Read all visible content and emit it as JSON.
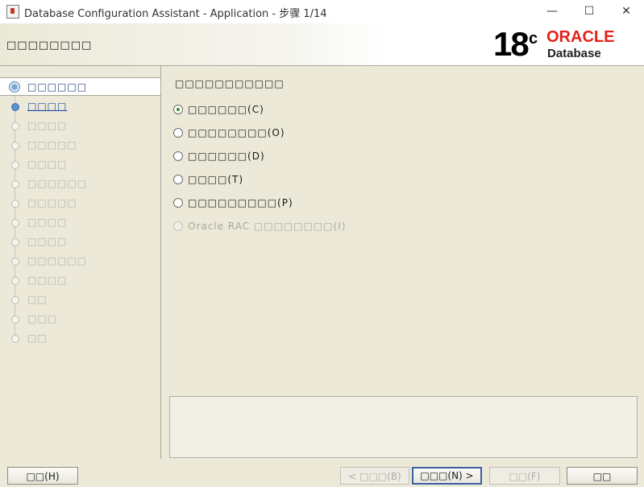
{
  "window": {
    "title": "Database Configuration Assistant - Application - 步骤 1/14",
    "controls": {
      "minimize": "—",
      "maximize": "☐",
      "close": "✕"
    }
  },
  "header": {
    "title": "□□□□□□□□",
    "brand": {
      "version": "18",
      "superscript": "c",
      "vendor": "ORACLE",
      "product": "Database"
    }
  },
  "steps": [
    {
      "label": "□□□□□□",
      "state": "current"
    },
    {
      "label": "□□□□",
      "state": "done"
    },
    {
      "label": "□□□□",
      "state": "pending"
    },
    {
      "label": "□□□□□",
      "state": "pending"
    },
    {
      "label": "□□□□",
      "state": "pending"
    },
    {
      "label": "□□□□□□",
      "state": "pending"
    },
    {
      "label": "□□□□□",
      "state": "pending"
    },
    {
      "label": "□□□□",
      "state": "pending"
    },
    {
      "label": "□□□□",
      "state": "pending"
    },
    {
      "label": "□□□□□□",
      "state": "pending"
    },
    {
      "label": "□□□□",
      "state": "pending"
    },
    {
      "label": "□□",
      "state": "pending"
    },
    {
      "label": "□□□",
      "state": "pending"
    },
    {
      "label": "□□",
      "state": "pending"
    }
  ],
  "main": {
    "question": "□□□□□□□□□□□",
    "options": [
      {
        "label": "□□□□□□(C)",
        "checked": true,
        "enabled": true
      },
      {
        "label": "□□□□□□□□(O)",
        "checked": false,
        "enabled": true
      },
      {
        "label": "□□□□□□(D)",
        "checked": false,
        "enabled": true
      },
      {
        "label": "□□□□(T)",
        "checked": false,
        "enabled": true
      },
      {
        "label": "□□□□□□□□□(P)",
        "checked": false,
        "enabled": true
      },
      {
        "label": "Oracle RAC □□□□□□□□(I)",
        "checked": false,
        "enabled": false
      }
    ]
  },
  "buttons": {
    "help": "□□(H)",
    "back": "< □□□(B)",
    "next": "□□□(N) >",
    "finish": "□□(F)",
    "cancel": "□□"
  },
  "colors": {
    "accent": "#e2231a",
    "link": "#1e4aa0",
    "selected_radio": "#3b8a2a"
  }
}
